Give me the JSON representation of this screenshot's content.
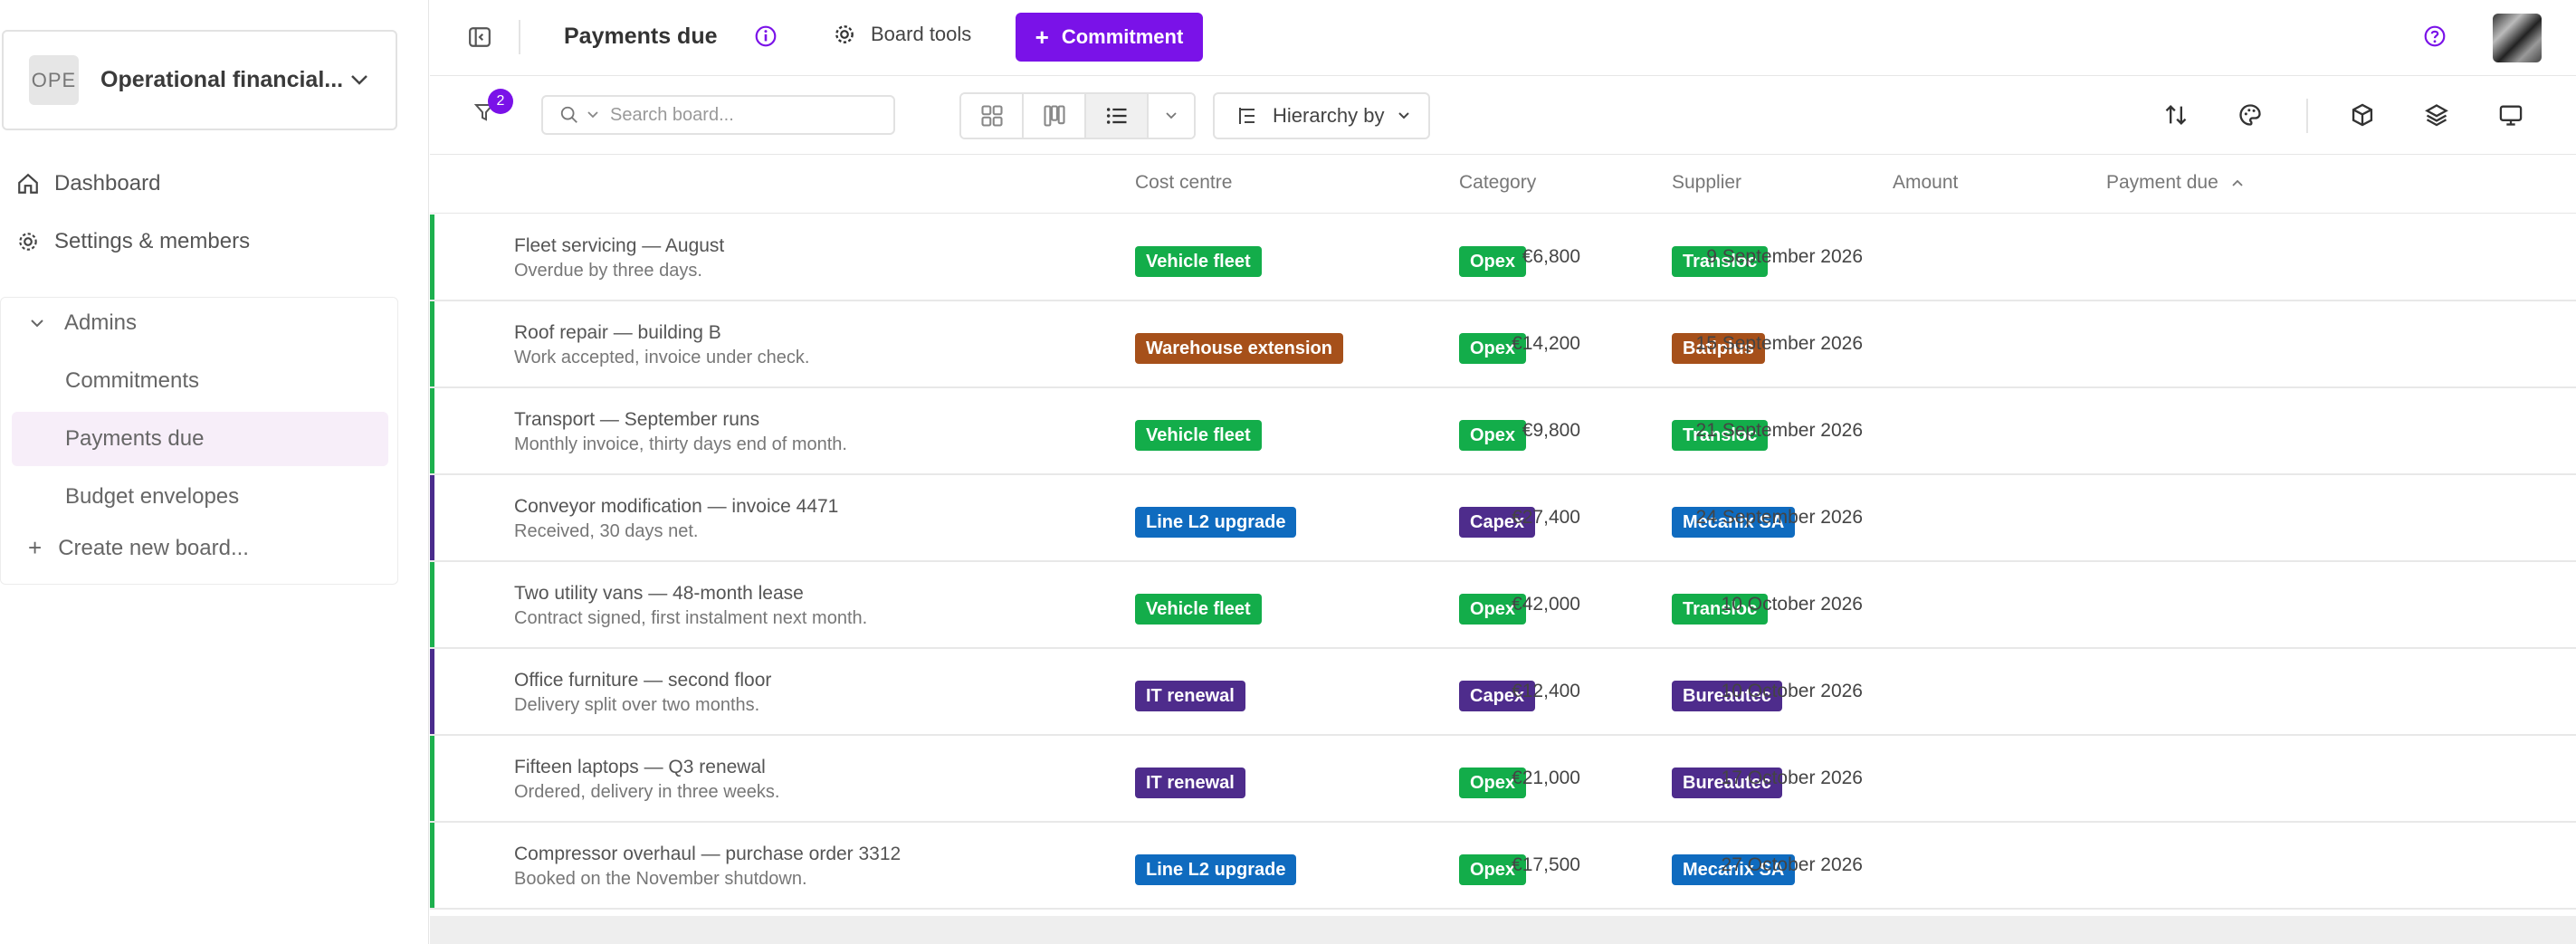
{
  "sidebar": {
    "workspace": {
      "avatar_text": "OPE",
      "name": "Operational financial..."
    },
    "nav": {
      "dashboard": "Dashboard",
      "settings": "Settings & members"
    },
    "group": {
      "label": "Admins",
      "boards": [
        {
          "label": "Commitments",
          "active": false
        },
        {
          "label": "Payments due",
          "active": true
        },
        {
          "label": "Budget envelopes",
          "active": false
        }
      ],
      "create_label": "Create new board..."
    }
  },
  "topbar": {
    "title": "Payments due",
    "board_tools": "Board tools",
    "commit_button": "Commitment"
  },
  "toolbar": {
    "filter_count": "2",
    "search_placeholder": "Search board...",
    "hierarchy_label": "Hierarchy by"
  },
  "table": {
    "columns": {
      "cost_centre": "Cost centre",
      "category": "Category",
      "supplier": "Supplier",
      "amount": "Amount",
      "payment_due": "Payment due"
    },
    "rows": [
      {
        "title": "Fleet servicing — August",
        "subtitle": "Overdue by three days.",
        "cost_centre": "Vehicle fleet",
        "category": "Opex",
        "supplier": "Transloc",
        "amount": "€6,800",
        "due": "9 September 2026",
        "bar": "#1db04e"
      },
      {
        "title": "Roof repair — building B",
        "subtitle": "Work accepted, invoice under check.",
        "cost_centre": "Warehouse extension",
        "category": "Opex",
        "supplier": "Batiplus",
        "amount": "€14,200",
        "due": "15 September 2026",
        "bar": "#1db04e"
      },
      {
        "title": "Transport — September runs",
        "subtitle": "Monthly invoice, thirty days end of month.",
        "cost_centre": "Vehicle fleet",
        "category": "Opex",
        "supplier": "Transloc",
        "amount": "€9,800",
        "due": "21 September 2026",
        "bar": "#1db04e"
      },
      {
        "title": "Conveyor modification — invoice 4471",
        "subtitle": "Received, 30 days net.",
        "cost_centre": "Line L2 upgrade",
        "category": "Capex",
        "supplier": "Mecanix SA",
        "amount": "€27,400",
        "due": "24 September 2026",
        "bar": "#4a2c8c"
      },
      {
        "title": "Two utility vans — 48-month lease",
        "subtitle": "Contract signed, first instalment next month.",
        "cost_centre": "Vehicle fleet",
        "category": "Opex",
        "supplier": "Transloc",
        "amount": "€42,000",
        "due": "10 October 2026",
        "bar": "#1db04e"
      },
      {
        "title": "Office furniture — second floor",
        "subtitle": "Delivery split over two months.",
        "cost_centre": "IT renewal",
        "category": "Capex",
        "supplier": "Bureautec",
        "amount": "€12,400",
        "due": "10 October 2026",
        "bar": "#4a2c8c"
      },
      {
        "title": "Fifteen laptops — Q3 renewal",
        "subtitle": "Ordered, delivery in three weeks.",
        "cost_centre": "IT renewal",
        "category": "Opex",
        "supplier": "Bureautec",
        "amount": "€21,000",
        "due": "17 October 2026",
        "bar": "#1db04e"
      },
      {
        "title": "Compressor overhaul — purchase order 3312",
        "subtitle": "Booked on the November shutdown.",
        "cost_centre": "Line L2 upgrade",
        "category": "Opex",
        "supplier": "Mecanix SA",
        "amount": "€17,500",
        "due": "27 October 2026",
        "bar": "#1db04e"
      }
    ]
  },
  "tag_colors": {
    "Vehicle fleet": "#13ad4a",
    "Warehouse extension": "#a6501a",
    "Line L2 upgrade": "#0f6bbf",
    "IT renewal": "#4e2c8c",
    "Opex": "#13ad4a",
    "Capex": "#4e2c8c",
    "Transloc": "#13ad4a",
    "Batiplus": "#a6501a",
    "Mecanix SA": "#0f6bbf",
    "Bureautec": "#4e2c8c"
  },
  "icons": {
    "collapse": "sidebar-collapse-icon",
    "info": "info-icon",
    "tools": "gear-icon",
    "help": "help-icon",
    "filter": "filter-icon",
    "search": "search-icon",
    "grid": "grid-view-icon",
    "kanban": "kanban-view-icon",
    "list": "list-view-icon",
    "sort": "sort-icon",
    "palette": "palette-icon",
    "cube": "cube-icon",
    "layers": "layers-icon",
    "monitor": "monitor-icon"
  }
}
